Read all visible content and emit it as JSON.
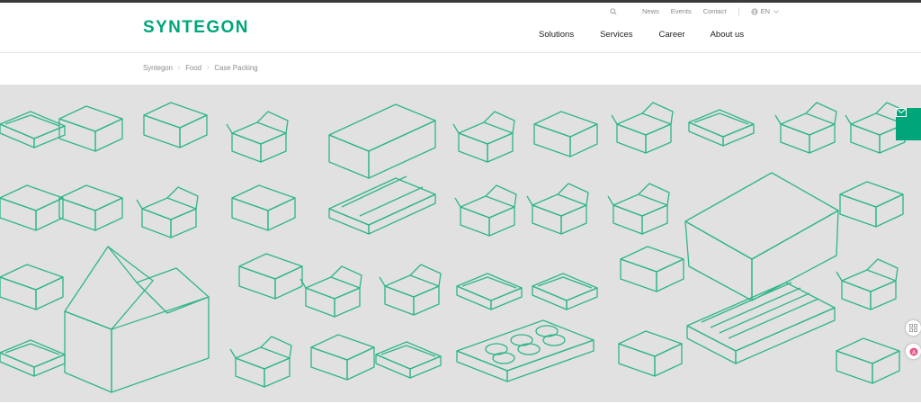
{
  "brand": {
    "logo_text": "SYNTEGON",
    "color": "#00a67a"
  },
  "utility_nav": {
    "news": "News",
    "events": "Events",
    "contact": "Contact",
    "language": "EN"
  },
  "main_nav": {
    "items": [
      "Solutions",
      "Services",
      "Career",
      "About us"
    ]
  },
  "breadcrumb": {
    "items": [
      "Syntegon",
      "Food",
      "Case Packing"
    ]
  },
  "hero": {
    "background": "#e1e1e1",
    "line_color": "#2fb58a"
  },
  "icons": {
    "search": "search-icon",
    "globe": "globe-icon",
    "chevron": "chevron-down-icon",
    "mail": "mail-icon",
    "grid": "grid-icon",
    "translate": "translate-icon"
  }
}
